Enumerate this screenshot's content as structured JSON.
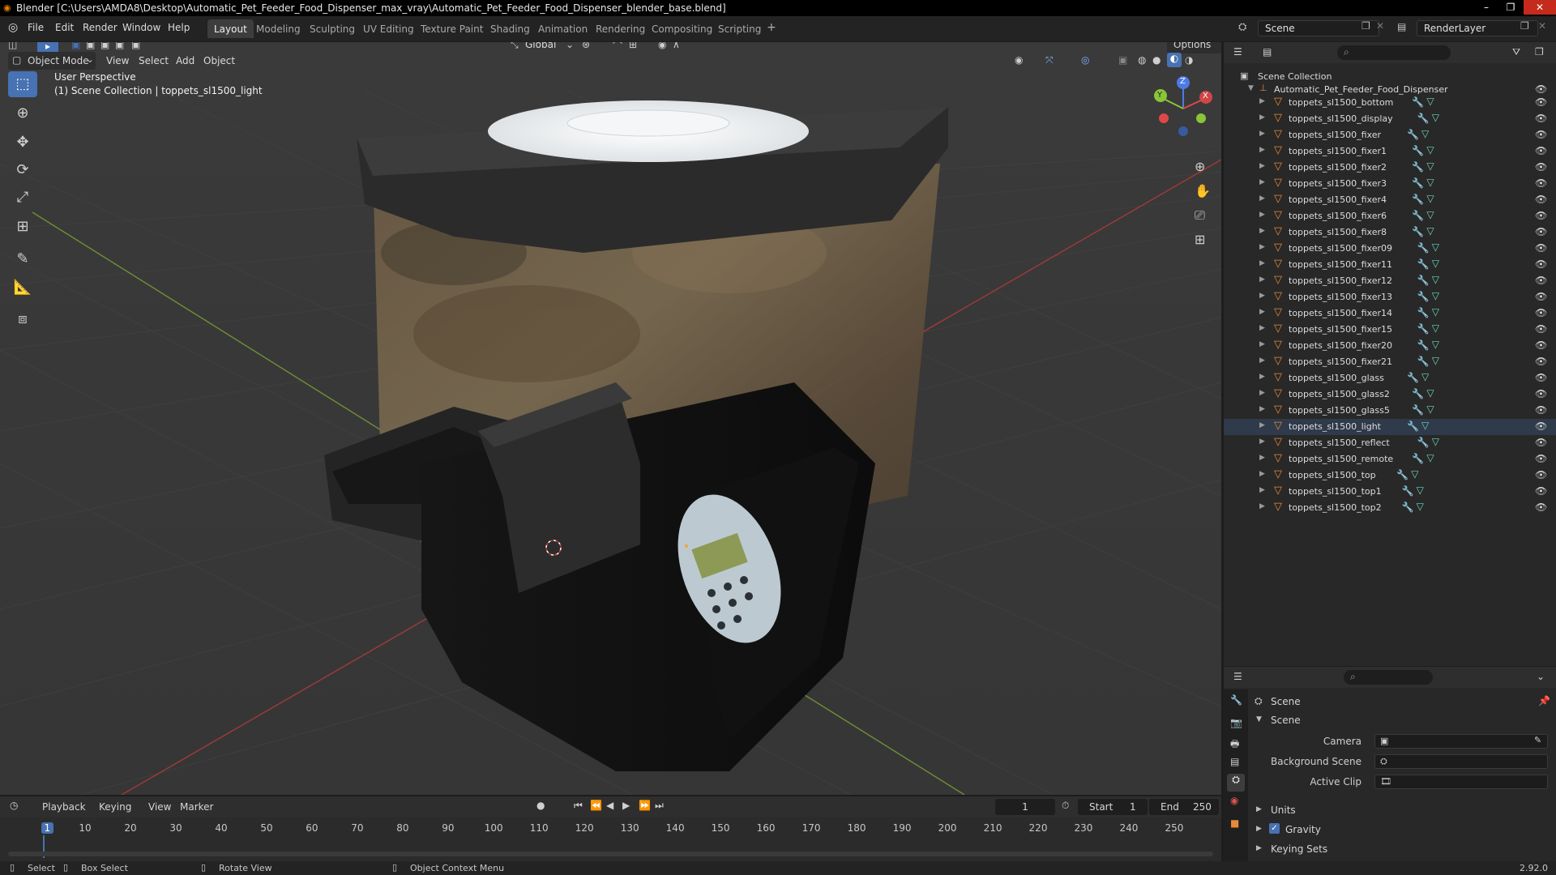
{
  "window": {
    "title": "Blender [C:\\Users\\AMDA8\\Desktop\\Automatic_Pet_Feeder_Food_Dispenser_max_vray\\Automatic_Pet_Feeder_Food_Dispenser_blender_base.blend]",
    "minimize": "–",
    "maximize": "❐",
    "close": "✕"
  },
  "menu": {
    "file": "File",
    "edit": "Edit",
    "render": "Render",
    "window": "Window",
    "help": "Help"
  },
  "workspaces": [
    "Layout",
    "Modeling",
    "Sculpting",
    "UV Editing",
    "Texture Paint",
    "Shading",
    "Animation",
    "Rendering",
    "Compositing",
    "Scripting"
  ],
  "active_workspace": "Layout",
  "add_workspace": "+",
  "scene_selector": {
    "value": "Scene"
  },
  "view_layer_selector": {
    "value": "RenderLayer"
  },
  "viewport": {
    "mode": "Object Mode",
    "menus": [
      "View",
      "Select",
      "Add",
      "Object"
    ],
    "transform_orientation": "Global",
    "options": "Options",
    "info_line1": "User Perspective",
    "info_line2": "(1) Scene Collection | toppets_sl1500_light",
    "gizmo_z": "Z",
    "gizmo_y": "Y",
    "gizmo_x": "X"
  },
  "outliner": {
    "root": "Scene Collection",
    "collection": "Automatic_Pet_Feeder_Food_Dispenser",
    "objects": [
      "toppets_sl1500_bottom",
      "toppets_sl1500_display",
      "toppets_sl1500_fixer",
      "toppets_sl1500_fixer1",
      "toppets_sl1500_fixer2",
      "toppets_sl1500_fixer3",
      "toppets_sl1500_fixer4",
      "toppets_sl1500_fixer6",
      "toppets_sl1500_fixer8",
      "toppets_sl1500_fixer09",
      "toppets_sl1500_fixer11",
      "toppets_sl1500_fixer12",
      "toppets_sl1500_fixer13",
      "toppets_sl1500_fixer14",
      "toppets_sl1500_fixer15",
      "toppets_sl1500_fixer20",
      "toppets_sl1500_fixer21",
      "toppets_sl1500_glass",
      "toppets_sl1500_glass2",
      "toppets_sl1500_glass5",
      "toppets_sl1500_light",
      "toppets_sl1500_reflect",
      "toppets_sl1500_remote",
      "toppets_sl1500_top",
      "toppets_sl1500_top1",
      "toppets_sl1500_top2"
    ],
    "active_object": "toppets_sl1500_light"
  },
  "properties": {
    "context": "Scene",
    "panel": "Scene",
    "camera_label": "Camera",
    "background_scene_label": "Background Scene",
    "active_clip_label": "Active Clip",
    "units": "Units",
    "gravity": "Gravity",
    "keying_sets": "Keying Sets"
  },
  "timeline": {
    "menus": [
      "Playback",
      "Keying",
      "View",
      "Marker"
    ],
    "current_frame": "1",
    "start_label": "Start",
    "start_value": "1",
    "end_label": "End",
    "end_value": "250",
    "ruler": [
      "1",
      "10",
      "20",
      "30",
      "40",
      "50",
      "60",
      "70",
      "80",
      "90",
      "100",
      "110",
      "120",
      "130",
      "140",
      "150",
      "160",
      "170",
      "180",
      "190",
      "200",
      "210",
      "220",
      "230",
      "240",
      "250"
    ]
  },
  "statusbar": {
    "select": "Select",
    "box_select": "Box Select",
    "rotate_view": "Rotate View",
    "context_menu": "Object Context Menu",
    "version": "2.92.0"
  },
  "colors": {
    "accent": "#4772b3",
    "object_icon": "#e68a3a",
    "background": "#393939"
  }
}
